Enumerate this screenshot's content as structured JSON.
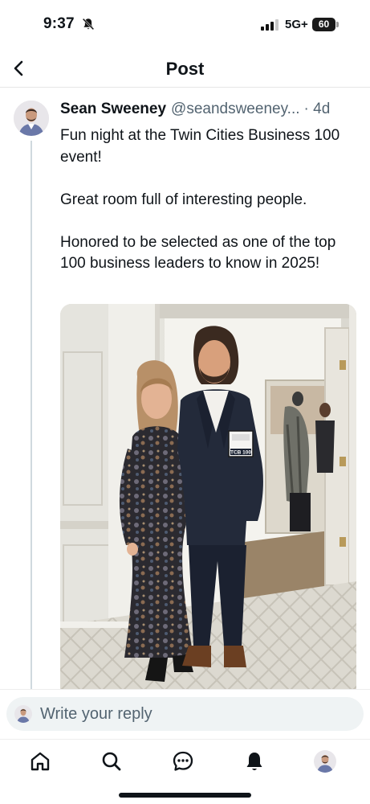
{
  "status_bar": {
    "time": "9:37",
    "network": "5G+",
    "battery": "60"
  },
  "header": {
    "title": "Post"
  },
  "post": {
    "author_name": "Sean Sweeney",
    "author_handle": "@seandsweeney...",
    "time": "· 4d",
    "paragraphs": [
      "Fun night at the Twin Cities Business 100 event!",
      "Great room full of interesting people.",
      "Honored to be selected as one of the top 100 business leaders to know in 2025!"
    ],
    "badge_text": "TCB 100"
  },
  "reply": {
    "placeholder": "Write your reply"
  },
  "tab_bar": {
    "icons": [
      "home-icon",
      "search-icon",
      "messages-icon",
      "notifications-icon",
      "profile-avatar"
    ]
  },
  "colors": {
    "text": "#0f1419",
    "secondary": "#536471",
    "thread_line": "#cfd9de",
    "reply_field": "#eff3f4"
  }
}
